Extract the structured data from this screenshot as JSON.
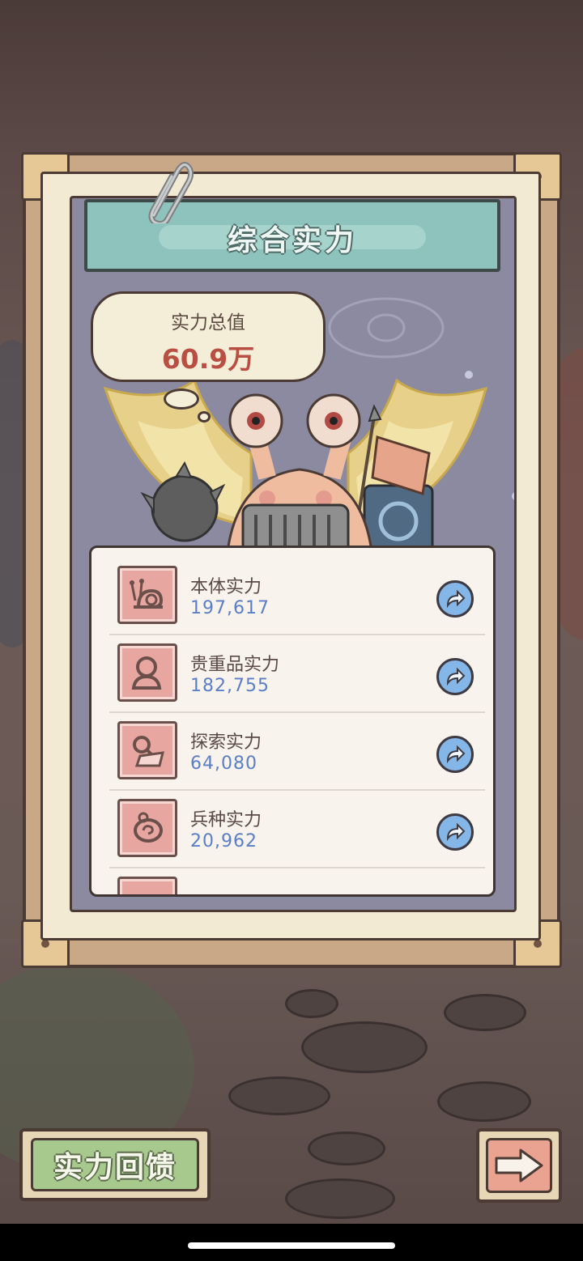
{
  "panel": {
    "title": "综合实力"
  },
  "total": {
    "label": "实力总值",
    "value": "60.9万"
  },
  "stats": [
    {
      "name": "本体实力",
      "value": "197,617",
      "icon": "snail-icon"
    },
    {
      "name": "贵重品实力",
      "value": "182,755",
      "icon": "statue-bust-icon"
    },
    {
      "name": "探索实力",
      "value": "64,080",
      "icon": "magnifier-map-icon"
    },
    {
      "name": "兵种实力",
      "value": "20,962",
      "icon": "ammonite-icon"
    }
  ],
  "footer": {
    "feedback_label": "实力回馈",
    "next_icon": "arrow-right-icon"
  },
  "colors": {
    "value_red": "#b94f43",
    "value_blue": "#5b7ec8",
    "banner_teal": "#8ec2bc",
    "button_green": "#a8c98e",
    "button_salmon": "#eba391"
  }
}
